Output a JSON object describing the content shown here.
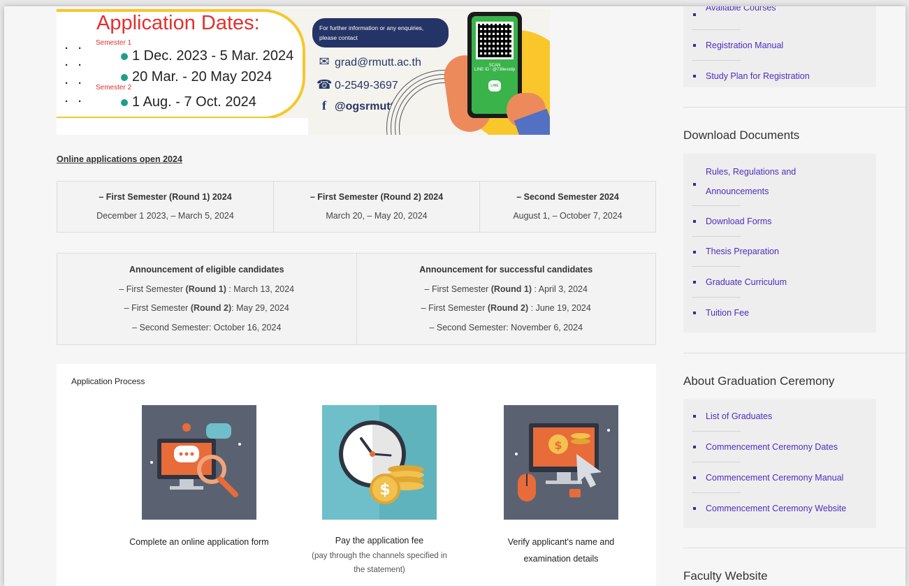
{
  "banner": {
    "title": "Application Dates:",
    "semester1_label": "Semester 1",
    "semester2_label": "Semester 2",
    "date1": "1 Dec. 2023 -  5 Mar. 2024",
    "date2": "20 Mar. -  20 May 2024",
    "date3": "1 Aug. -  7 Oct. 2024",
    "contact_note": "For further information or any enquiries, please contact",
    "email": "grad@rmutt.ac.th",
    "phone": "0-2549-3697",
    "facebook": "@ogsrmutt",
    "scan_label": "SCAN",
    "line_id": "LINE ID : @738evxdp",
    "line_icon": "LINE"
  },
  "main": {
    "open_link": "Online applications open 2024",
    "application_periods": [
      {
        "heading": "– First Semester (Round 1) 2024",
        "dates": "December 1 2023, – March 5, 2024"
      },
      {
        "heading": "– First Semester (Round 2) 2024",
        "dates": "March 20, – May 20, 2024"
      },
      {
        "heading": "– Second Semester 2024",
        "dates": "August 1, – October 7, 2024"
      }
    ],
    "announcements": {
      "eligible": {
        "heading": "Announcement of eligible candidates",
        "l1_pre": "– First Semester ",
        "l1_bold": "(Round 1)",
        "l1_post": " : March 13, 2024",
        "l2_pre": "– First Semester ",
        "l2_bold": "(Round 2)",
        "l2_post": ": May 29, 2024",
        "l3": "– Second Semester: October 16, 2024"
      },
      "successful": {
        "heading": "Announcement for successful candidates",
        "l1_pre": "– First Semester ",
        "l1_bold": "(Round 1)",
        "l1_post": " : April 3, 2024",
        "l2_pre": "– First Semester ",
        "l2_bold": "(Round 2)",
        "l2_post": " : June 19, 2024",
        "l3": "– Second Semester: November 6, 2024"
      }
    },
    "process": {
      "title": "Application Process",
      "steps": [
        {
          "caption": "Complete an online application form",
          "icon": "online-form-icon"
        },
        {
          "caption": "Pay the application fee",
          "sub1": "(pay through the channels specified in",
          "sub2": "the statement)",
          "icon": "clock-coins-icon"
        },
        {
          "caption1": "Verify applicant's name and",
          "caption2": "examination details",
          "icon": "computer-cursor-icon"
        }
      ]
    }
  },
  "sidebar": {
    "top_links": [
      "Available Courses",
      "Registration Manual",
      "Study Plan for Registration"
    ],
    "download_title": "Download Documents",
    "download_links": [
      "Rules, Regulations and",
      "Announcements",
      "Download Forms",
      "Thesis Preparation",
      "Graduate Curriculum",
      "Tuition Fee"
    ],
    "graduation_title": "About Graduation Ceremony",
    "graduation_links": [
      "List of Graduates",
      "Commencement Ceremony Dates",
      "Commencement Ceremony Manual",
      "Commencement Ceremony Website"
    ],
    "faculty_title": "Faculty Website"
  },
  "colors": {
    "link": "#4d2dbf",
    "banner_red": "#e0312f",
    "banner_navy": "#253466",
    "accent_yellow": "#f5c82a",
    "teal": "#1e9e8a"
  }
}
